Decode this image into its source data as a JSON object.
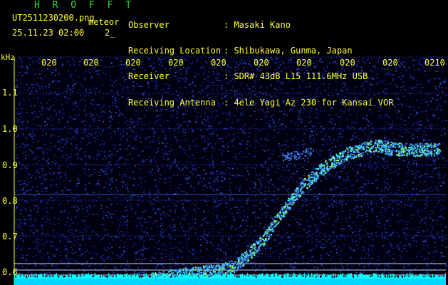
{
  "header": {
    "app": "H R O F F T",
    "filename": "UT2511230200.png",
    "tag": "meteor",
    "datetime": "25.11.23 02:00    2_",
    "info": [
      {
        "label": "Observer",
        "value": ": Masaki Kano"
      },
      {
        "label": "Receiving Location",
        "value": ": Shibukawa, Gunma, Japan"
      },
      {
        "label": "Receiver",
        "value": ": SDR# 43dB L15 111.6MHz USB"
      },
      {
        "label": "Receiving Antenna",
        "value": ": 4ele Yagi Az 230 for Kansai VOR"
      }
    ]
  },
  "axes": {
    "y_unit": "kHz",
    "y_ticks": [
      "1.1",
      "1.0",
      "0.9",
      "0.8",
      "0.7",
      "0.6"
    ],
    "x_ticks": [
      "020",
      "020",
      "020",
      "020",
      "020",
      "020",
      "020",
      "020",
      "020",
      "0210"
    ]
  },
  "colors": {
    "background": "#000000",
    "label_yellow": "#ffff33",
    "title_green": "#33dd33",
    "noise_blue": "#1a2a9a",
    "signal_cyan": "#40e0ff",
    "signal_green": "#9aff6a",
    "base_cyan": "#00ffff"
  }
}
